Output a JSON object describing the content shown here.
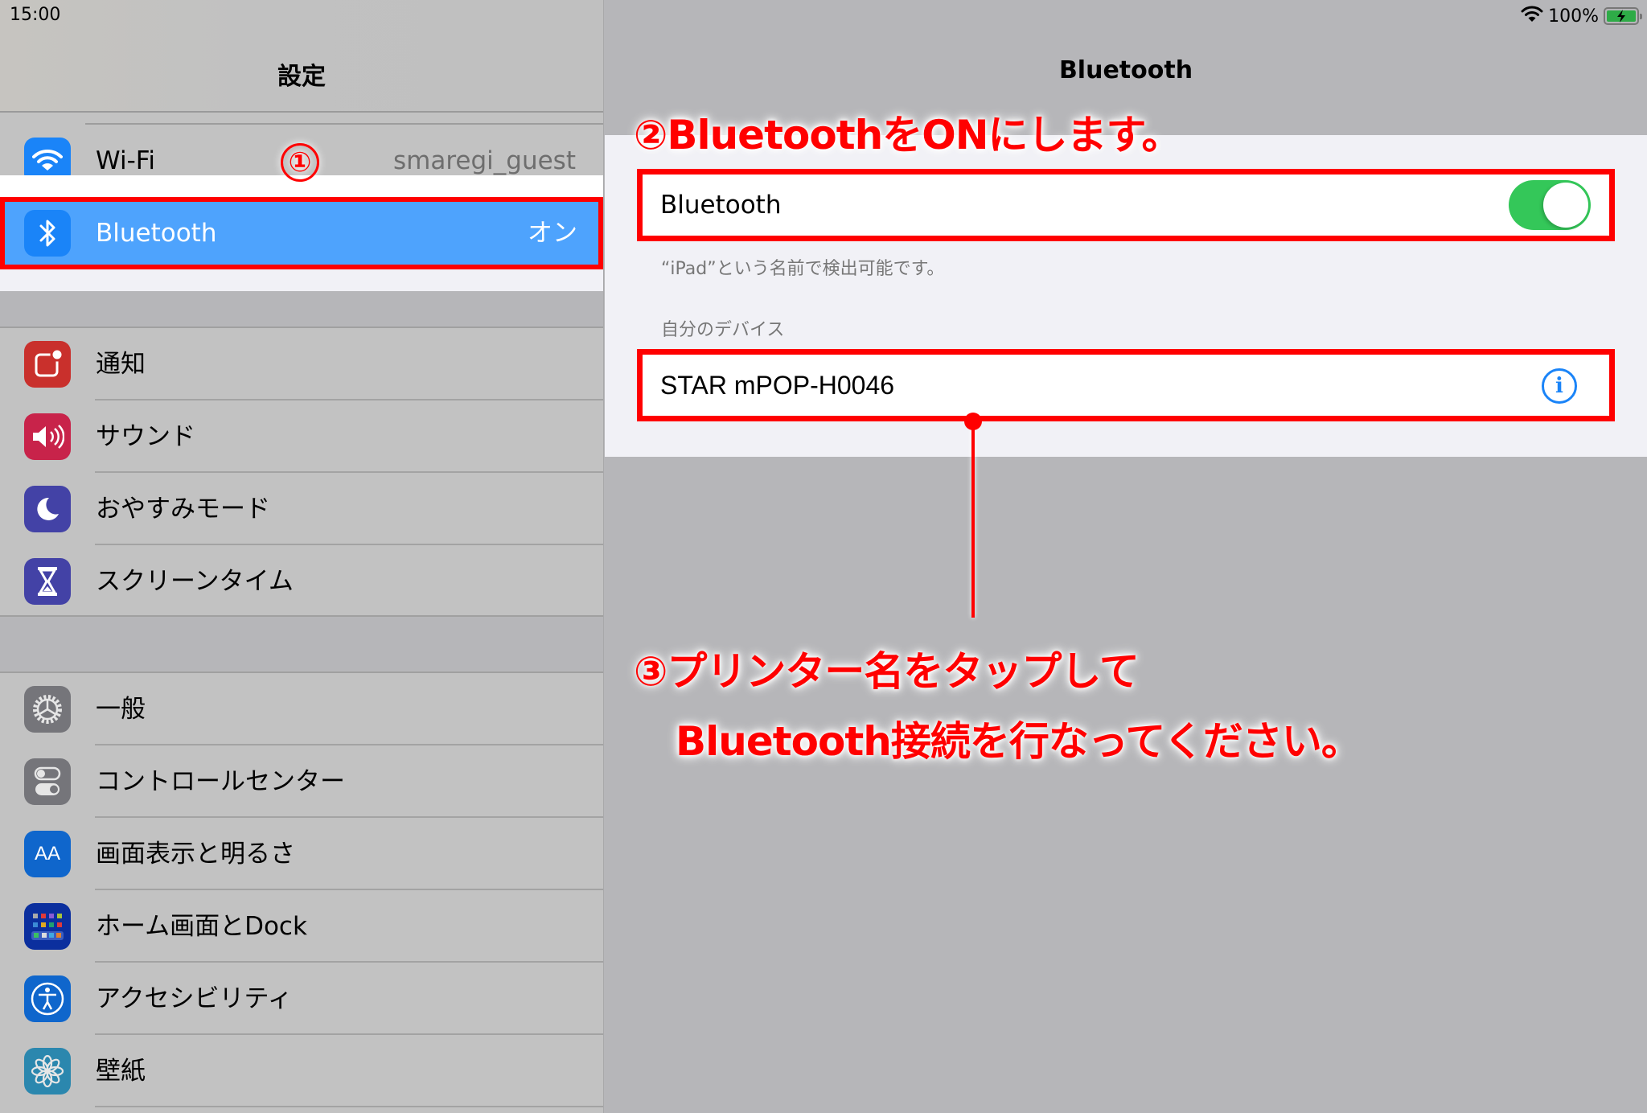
{
  "status_bar": {
    "time": "15:00",
    "battery_percent": "100%",
    "battery_level": 1.0,
    "charging": true,
    "wifi_icon": "wifi-icon",
    "battery_icon": "battery-charging-icon"
  },
  "sidebar": {
    "title": "設定",
    "wifi": {
      "label": "Wi-Fi",
      "value": "smaregi_guest",
      "icon": "wifi-icon",
      "color": "#1a84f8"
    },
    "bluetooth": {
      "label": "Bluetooth",
      "value": "オン",
      "icon": "bluetooth-icon",
      "color": "#1a84f8",
      "selected": true
    },
    "group2": [
      {
        "label": "通知",
        "icon": "notifications-icon",
        "color": "#c9302c"
      },
      {
        "label": "サウンド",
        "icon": "sound-icon",
        "color": "#c8234a"
      },
      {
        "label": "おやすみモード",
        "icon": "moon-icon",
        "color": "#4342a6"
      },
      {
        "label": "スクリーンタイム",
        "icon": "hourglass-icon",
        "color": "#4342a6"
      }
    ],
    "group3": [
      {
        "label": "一般",
        "icon": "gear-icon",
        "color": "#75757a"
      },
      {
        "label": "コントロールセンター",
        "icon": "control-center-icon",
        "color": "#75757a"
      },
      {
        "label": "画面表示と明るさ",
        "icon": "display-brightness-icon",
        "color": "#0f66cc",
        "glyph": "AA"
      },
      {
        "label": "ホーム画面とDock",
        "icon": "home-screen-icon",
        "color": "#0b2f9e"
      },
      {
        "label": "アクセシビリティ",
        "icon": "accessibility-icon",
        "color": "#0f66cc"
      },
      {
        "label": "壁紙",
        "icon": "wallpaper-icon",
        "color": "#2b87ae"
      }
    ]
  },
  "detail": {
    "title": "Bluetooth",
    "bluetooth_toggle": {
      "label": "Bluetooth",
      "on": true,
      "color": "#34c759"
    },
    "discoverable_note": "“iPad”という名前で検出可能です。",
    "my_devices_header": "自分のデバイス",
    "devices": [
      {
        "name": "STAR mPOP-H0046",
        "info_icon": "info-icon"
      }
    ]
  },
  "annotations": {
    "step1": "①",
    "step2": "②BluetoothをONにします。",
    "step3_line1": "③プリンター名をタップして",
    "step3_line2": "Bluetooth接続を行なってください。",
    "color": "#ff0000"
  }
}
